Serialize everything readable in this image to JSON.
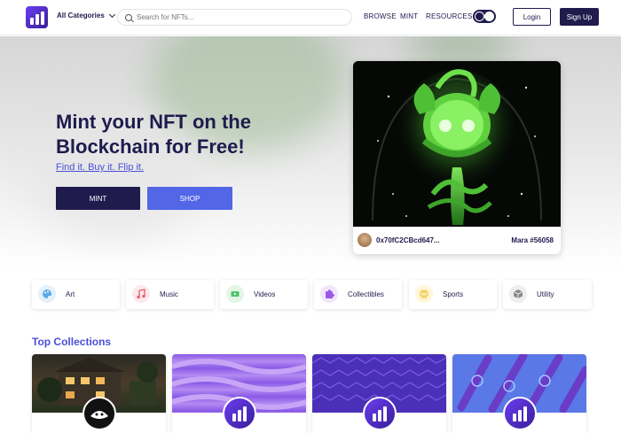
{
  "header": {
    "categories_label": "All Categories",
    "search_placeholder": "Search for NFTs...",
    "nav": [
      "BROWSE",
      "MINT",
      "RESOURCES"
    ],
    "login_label": "Login",
    "signup_label": "Sign Up"
  },
  "hero": {
    "headline": "Mint your NFT on the Blockchain for Free!",
    "tagline": "Find it. Buy it. Flip it.",
    "mint_label": "MINT",
    "shop_label": "SHOP",
    "featured": {
      "owner_address": "0x70fC2CBcd647...",
      "nft_name": "Mara #56058"
    }
  },
  "categories": [
    {
      "label": "Art",
      "icon": "palette-icon",
      "color": "#e3f1fb"
    },
    {
      "label": "Music",
      "icon": "music-note-icon",
      "color": "#fde8ea"
    },
    {
      "label": "Videos",
      "icon": "video-icon",
      "color": "#e3f6e6"
    },
    {
      "label": "Collectibles",
      "icon": "puzzle-icon",
      "color": "#f1e6fb"
    },
    {
      "label": "Sports",
      "icon": "ball-icon",
      "color": "#fff6d8"
    },
    {
      "label": "Utility",
      "icon": "cube-icon",
      "color": "#eeeeee"
    }
  ],
  "collections": {
    "title": "Top Collections"
  },
  "colors": {
    "navy": "#1f1b4d",
    "accent_blue": "#5266e6",
    "link_blue": "#4a4fd8",
    "brand_purple": "#6a3df0"
  }
}
